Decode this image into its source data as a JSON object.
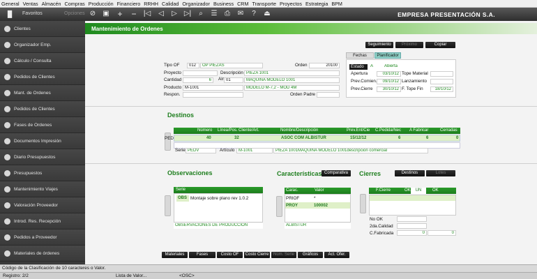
{
  "menu": [
    "General",
    "Ventas",
    "Almacén",
    "Compras",
    "Producción",
    "Financiero",
    "RRHH",
    "Calidad",
    "Organizador",
    "Business",
    "CRM",
    "Transporte",
    "Proyectos",
    "Estrategia",
    "BPM"
  ],
  "toolbar": {
    "favoritos": "Favoritos",
    "opciones": "Opciones",
    "company": "EMPRESA PRESENTACIÓN  S.A."
  },
  "sidebar": [
    "Clientes",
    "Organizador Emp.",
    "Cálculo / Consulta",
    "Pedidos de Clientes",
    "Mant. de Ordenes",
    "Pedidos de Clientes",
    "Fases de Ordenes",
    "Documentos Impresión",
    "Diario Presupuestos",
    "Presupuestos",
    "Mantenimiento Viajes",
    "Valoración Proveedor",
    "Introd. Res. Recepción",
    "Pedidos a Proveedor",
    "Materiales de órdenes"
  ],
  "title": "Mantenimiento de Ordenes",
  "top_buttons": {
    "seguimiento": "Seguimiento",
    "proximo": "Próximo",
    "copiar": "Copiar"
  },
  "form": {
    "tipo_of_label": "Tipo OF",
    "tipo_of": "012",
    "tipo_of_desc": "OP PIEZAS",
    "orden_label": "Orden",
    "orden": "20100",
    "proyecto_label": "Proyecto",
    "proyecto": "",
    "descripcion_label": "Descripción",
    "descripcion": "PIEZA 1001",
    "cantidad_label": "Cantidad",
    "cantidad": "6",
    "alm_label": "Alm",
    "alm": "01",
    "alm_desc": "MAQUINA MODELO 1001",
    "producto_label": "Producto",
    "producto": "M-1001",
    "producto_desc": "MODELO M-7,2 - MOD 4M",
    "respon_label": "Respon.",
    "respon": "",
    "orden_padre_label": "Orden Padre",
    "orden_padre": ""
  },
  "tabs": {
    "fechas": "Fechas",
    "planificador": "Planificador"
  },
  "fechas": {
    "estado_label": "Estado",
    "estado": "A",
    "estado_desc": "Abierta",
    "apertura_label": "Apertura",
    "apertura": "03/10/12",
    "tope_material_label": "Tope Material",
    "tope_material": "",
    "prev_comien_label": "Prev.Comien.",
    "prev_comien": "09/10/12",
    "lanzamiento_label": "Lanzamiento",
    "lanzamiento": "",
    "prev_cierre_label": "Prev.Cierre",
    "prev_cierre": "30/10/12",
    "f_tope_fin_label": "F. Tope Fin",
    "f_tope_fin": "18/10/12"
  },
  "destinos": {
    "title": "Destinos",
    "headers": [
      "Número",
      "Línea/Pos.",
      "Cliente/Art.",
      "Nombre/Descripción",
      "Prev.Ent/Cie",
      "C.Pedida/Nec",
      "A Fabricar",
      "Cerradas"
    ],
    "row": {
      "tipo": "PED",
      "numero": "40",
      "linea": "32",
      "nombre": "ASOC COM ALBISTUR",
      "prev": "15/12/12",
      "pedida": "6",
      "fabricar": "6",
      "cerradas": "0"
    },
    "serie_label": "Serie",
    "serie": "PEDV",
    "articulo_label": "Artículo",
    "articulo": "M-1001",
    "articulo_desc": "PIEZA 1001MAQUINA MODELO 1001descripcion  comercial"
  },
  "observaciones": {
    "title": "Observaciones",
    "header": "Serie",
    "code": "OBS",
    "text": "Montaje sobre plano rev 1.0.2",
    "footer": "OBSERVACIONES DE PRODUCCION"
  },
  "caracteristicas": {
    "title": "Características",
    "comparativa": "Comparativa",
    "headers": [
      "Carac.",
      "Valor"
    ],
    "rows": [
      {
        "c": "PRIOF",
        "v": "*"
      },
      {
        "c": "PROY",
        "v": "100002"
      }
    ],
    "footer": "ALBISTUR"
  },
  "cierres": {
    "title": "Cierres",
    "destinos_btn": "Destinos",
    "lotes_btn": "Lotes",
    "header": "F.Cierre",
    "ok1": "OK",
    "un": "UN",
    "ok2": "OK",
    "no_ok_label": "No OK",
    "no_ok": "",
    "segunda_label": "2da.Calidad",
    "segunda": "",
    "fabricada_label": "C.Fabricada",
    "fabricada1": "0",
    "fabricada2": "0"
  },
  "bottom_buttons": [
    "Materiales",
    "Fases",
    "Costo OF",
    "Costo Cierre",
    "Núm. Serie",
    "Gráficos",
    "Act. Ofer."
  ],
  "status": {
    "message": "Código de la Clasificación de 10 caracteres o Valor.",
    "registro": "Registro: 2/2",
    "lista": "Lista de Valor...",
    "osc": "<OSC>"
  }
}
